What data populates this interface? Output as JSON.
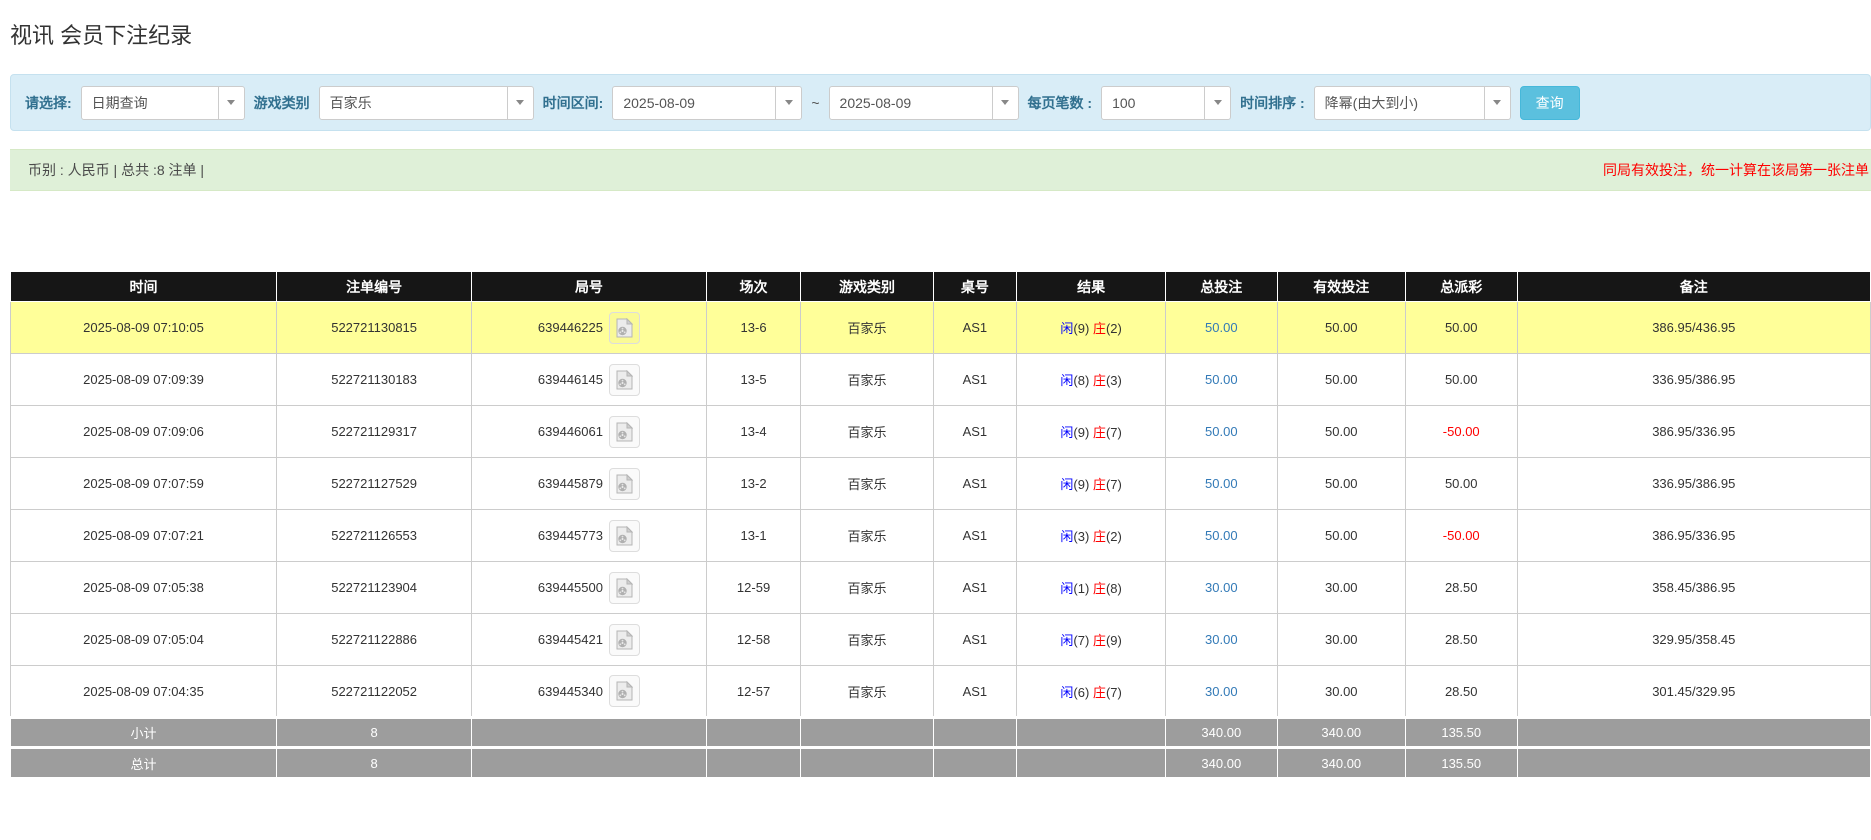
{
  "page": {
    "title": "视讯 会员下注纪录"
  },
  "filters": {
    "select_label": "请选择:",
    "select_value": "日期查询",
    "game_type_label": "游戏类别",
    "game_type_value": "百家乐",
    "time_range_label": "时间区间:",
    "date_from": "2025-08-09",
    "tilde": "~",
    "date_to": "2025-08-09",
    "page_size_label": "每页笔数 :",
    "page_size_value": "100",
    "sort_label": "时间排序 :",
    "sort_value": "降幂(由大到小)",
    "search_button": "查询"
  },
  "summary": {
    "left": "币别 : 人民币 | 总共 :8 注单 |",
    "right_notice": "同局有效投注，统一计算在该局第一张注单"
  },
  "table": {
    "headers": [
      "时间",
      "注单编号",
      "局号",
      "场次",
      "游戏类别",
      "桌号",
      "结果",
      "总投注",
      "有效投注",
      "总派彩",
      "备注"
    ],
    "rows": [
      {
        "time": "2025-08-09 07:10:05",
        "bet_id": "522721130815",
        "round": "639446225",
        "session": "13-6",
        "game": "百家乐",
        "table_no": "AS1",
        "rp_label": "闲",
        "rp": "(9)",
        "rb_label": "庄",
        "rb": "(2)",
        "total_bet": "50.00",
        "valid_bet": "50.00",
        "payout": "50.00",
        "remark": "386.95/436.95",
        "highlighted": true
      },
      {
        "time": "2025-08-09 07:09:39",
        "bet_id": "522721130183",
        "round": "639446145",
        "session": "13-5",
        "game": "百家乐",
        "table_no": "AS1",
        "rp_label": "闲",
        "rp": "(8)",
        "rb_label": "庄",
        "rb": "(3)",
        "total_bet": "50.00",
        "valid_bet": "50.00",
        "payout": "50.00",
        "remark": "336.95/386.95",
        "highlighted": false
      },
      {
        "time": "2025-08-09 07:09:06",
        "bet_id": "522721129317",
        "round": "639446061",
        "session": "13-4",
        "game": "百家乐",
        "table_no": "AS1",
        "rp_label": "闲",
        "rp": "(9)",
        "rb_label": "庄",
        "rb": "(7)",
        "total_bet": "50.00",
        "valid_bet": "50.00",
        "payout": "-50.00",
        "remark": "386.95/336.95",
        "highlighted": false
      },
      {
        "time": "2025-08-09 07:07:59",
        "bet_id": "522721127529",
        "round": "639445879",
        "session": "13-2",
        "game": "百家乐",
        "table_no": "AS1",
        "rp_label": "闲",
        "rp": "(9)",
        "rb_label": "庄",
        "rb": "(7)",
        "total_bet": "50.00",
        "valid_bet": "50.00",
        "payout": "50.00",
        "remark": "336.95/386.95",
        "highlighted": false
      },
      {
        "time": "2025-08-09 07:07:21",
        "bet_id": "522721126553",
        "round": "639445773",
        "session": "13-1",
        "game": "百家乐",
        "table_no": "AS1",
        "rp_label": "闲",
        "rp": "(3)",
        "rb_label": "庄",
        "rb": "(2)",
        "total_bet": "50.00",
        "valid_bet": "50.00",
        "payout": "-50.00",
        "remark": "386.95/336.95",
        "highlighted": false
      },
      {
        "time": "2025-08-09 07:05:38",
        "bet_id": "522721123904",
        "round": "639445500",
        "session": "12-59",
        "game": "百家乐",
        "table_no": "AS1",
        "rp_label": "闲",
        "rp": "(1)",
        "rb_label": "庄",
        "rb": "(8)",
        "total_bet": "30.00",
        "valid_bet": "30.00",
        "payout": "28.50",
        "remark": "358.45/386.95",
        "highlighted": false
      },
      {
        "time": "2025-08-09 07:05:04",
        "bet_id": "522721122886",
        "round": "639445421",
        "session": "12-58",
        "game": "百家乐",
        "table_no": "AS1",
        "rp_label": "闲",
        "rp": "(7)",
        "rb_label": "庄",
        "rb": "(9)",
        "total_bet": "30.00",
        "valid_bet": "30.00",
        "payout": "28.50",
        "remark": "329.95/358.45",
        "highlighted": false
      },
      {
        "time": "2025-08-09 07:04:35",
        "bet_id": "522721122052",
        "round": "639445340",
        "session": "12-57",
        "game": "百家乐",
        "table_no": "AS1",
        "rp_label": "闲",
        "rp": "(6)",
        "rb_label": "庄",
        "rb": "(7)",
        "total_bet": "30.00",
        "valid_bet": "30.00",
        "payout": "28.50",
        "remark": "301.45/329.95",
        "highlighted": false
      }
    ],
    "subtotal": {
      "label": "小计",
      "count": "8",
      "total_bet": "340.00",
      "valid_bet": "340.00",
      "total_payout": "135.50"
    },
    "total": {
      "label": "总计",
      "count": "8",
      "total_bet": "340.00",
      "valid_bet": "340.00",
      "total_payout": "135.50"
    }
  },
  "icons": {
    "video_record": "video-record-icon",
    "dropdown": "chevron-down-icon"
  },
  "colors": {
    "panel_bg": "#d9edf7",
    "summary_bg": "#dff0d8",
    "accent_button": "#5bc0de",
    "header_bg": "#161616",
    "highlight_row": "#ffff99",
    "footer_bg": "#9d9d9d",
    "link_blue": "#337ab7",
    "player_blue": "#0000ff",
    "banker_red": "#ff0000",
    "notice_red": "#ff0000"
  }
}
